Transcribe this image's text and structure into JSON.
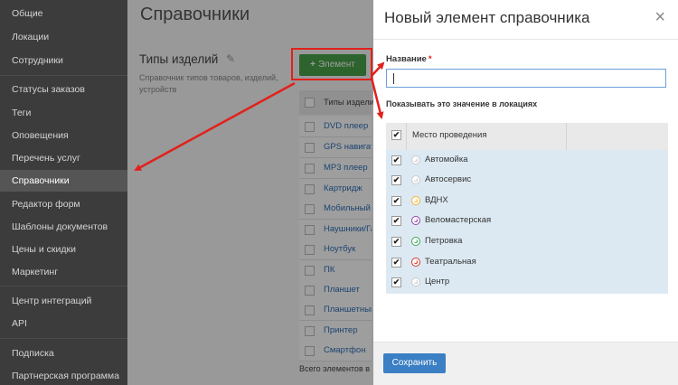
{
  "sidebar": {
    "items": [
      {
        "label": "Общие"
      },
      {
        "label": "Локации"
      },
      {
        "label": "Сотрудники"
      },
      {
        "label": "Статусы заказов"
      },
      {
        "label": "Теги"
      },
      {
        "label": "Оповещения"
      },
      {
        "label": "Перечень услуг"
      },
      {
        "label": "Справочники",
        "active": true
      },
      {
        "label": "Редактор форм"
      },
      {
        "label": "Шаблоны документов"
      },
      {
        "label": "Цены и скидки"
      },
      {
        "label": "Маркетинг"
      },
      {
        "label": "Центр интеграций"
      },
      {
        "label": "API"
      },
      {
        "label": "Подписка"
      },
      {
        "label": "Партнерская программа"
      }
    ]
  },
  "page": {
    "title": "Справочники",
    "section_title": "Типы изделий",
    "section_desc": "Справочник типов товаров, изделий, устройств",
    "add_button": "Элемент",
    "table_header": "Типы изделий",
    "rows": [
      "DVD плеер",
      "GPS навигатор",
      "MP3 плеер",
      "Картридж",
      "Мобильный",
      "Наушники/Гарнитура",
      "Ноутбук",
      "ПК",
      "Планшет",
      "Планшетный",
      "Принтер",
      "Смартфон"
    ],
    "footer": "Всего элементов в"
  },
  "modal": {
    "title": "Новый элемент справочника",
    "close_icon": "×",
    "name_label": "Название",
    "required_mark": "*",
    "name_value": "",
    "locations_label": "Показывать это значение в локациях",
    "locations_header": "Место проведения",
    "check_mark": "✔",
    "locations": [
      {
        "name": "Автомойка",
        "color": "#c8c8c8",
        "checked": true
      },
      {
        "name": "Автосервис",
        "color": "#c8c8c8",
        "checked": true
      },
      {
        "name": "ВДНХ",
        "color": "#f0b429",
        "checked": true
      },
      {
        "name": "Веломастерская",
        "color": "#8e44ad",
        "checked": true
      },
      {
        "name": "Петровка",
        "color": "#3aa757",
        "checked": true
      },
      {
        "name": "Театральная",
        "color": "#d9362b",
        "checked": true
      },
      {
        "name": "Центр",
        "color": "#c8c8c8",
        "checked": true
      }
    ],
    "save_button": "Сохранить"
  },
  "colors": {
    "annotation_red": "#e2211c",
    "accent_blue": "#3b7fc4",
    "add_green": "#49a049"
  }
}
